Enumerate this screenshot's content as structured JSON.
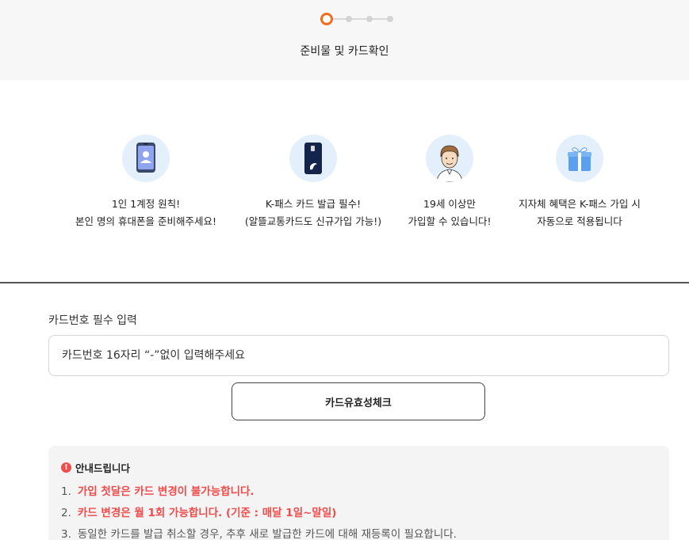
{
  "stepper": {
    "current_step": 1,
    "total_steps": 4,
    "title": "준비물 및 카드확인",
    "accent_color": "#f36c21"
  },
  "features": [
    {
      "icon": "smartphone-user-icon",
      "line1": "1인 1계정 원칙!",
      "line2": "본인 명의 휴대폰을 준비해주세요!"
    },
    {
      "icon": "transit-card-icon",
      "line1": "K-패스 카드 발급 필수!",
      "line2": "(알뜰교통카드도 신규가입 가능!)"
    },
    {
      "icon": "adult-person-icon",
      "line1": "19세 이상만",
      "line2": "가입할 수 있습니다!"
    },
    {
      "icon": "gift-box-icon",
      "line1": "지자체 혜택은 K-패스 가입 시",
      "line2": "자동으로 적용됩니다"
    }
  ],
  "card_form": {
    "label": "카드번호 필수 입력",
    "placeholder": "카드번호 16자리 “-”없이 입력해주세요",
    "value": "",
    "check_button": "카드유효성체크"
  },
  "notice": {
    "title": "안내드립니다",
    "alert_color": "#ef4c4c",
    "items": [
      {
        "num": "1.",
        "text": "가입 첫달은 카드 변경이 불가능합니다.",
        "emphasis": true
      },
      {
        "num": "2.",
        "text": "카드 변경은 월 1회 가능합니다. (기준 : 매달 1일~말일)",
        "emphasis": true
      },
      {
        "num": "3.",
        "text": "동일한 카드를 발급 취소할 경우, 추후 새로 발급한 카드에 대해 재등록이 필요합니다.",
        "emphasis": false
      }
    ]
  }
}
